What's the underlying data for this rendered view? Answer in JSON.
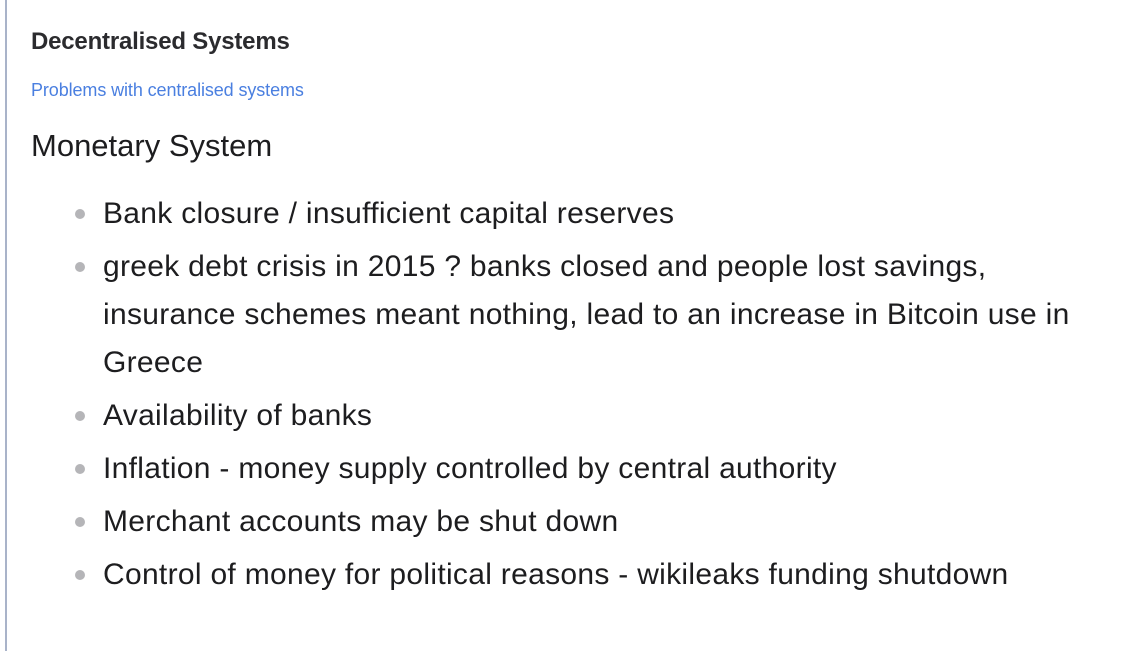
{
  "document": {
    "title": "Decentralised Systems",
    "section_link": "Problems with centralised systems",
    "heading": "Monetary System",
    "bullets": [
      "Bank closure / insufficient capital reserves",
      "greek debt crisis in 2015 ? banks closed and people lost savings, insurance schemes meant nothing, lead to an increase in Bitcoin use in Greece",
      "Availability of banks",
      "Inflation - money supply controlled by central authority",
      "Merchant accounts may be shut down",
      "Control of money for political reasons - wikileaks funding shutdown"
    ]
  },
  "colors": {
    "link": "#4a7fe0",
    "text": "#1d1d1f",
    "bullet": "#b5b5b8",
    "rule": "#a9b3c9"
  }
}
